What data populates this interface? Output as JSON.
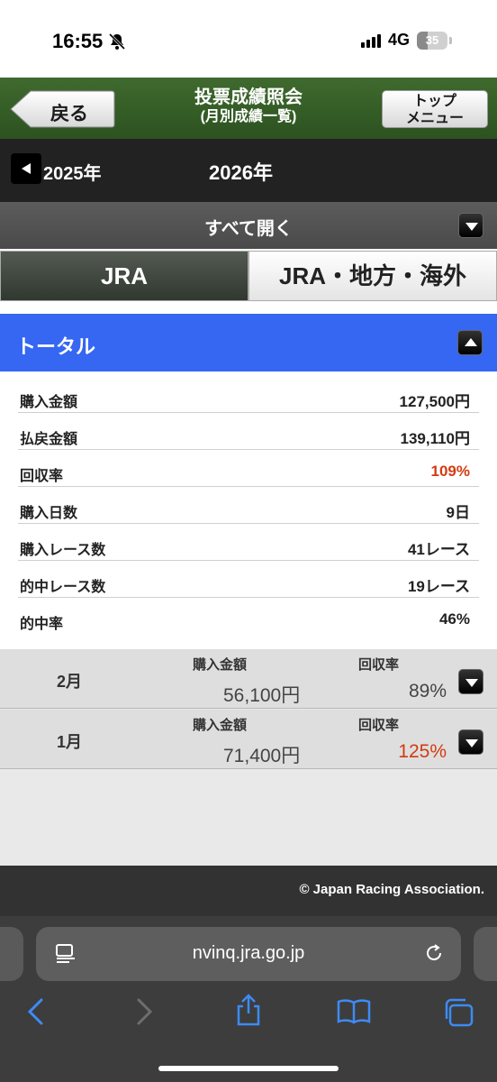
{
  "status_bar": {
    "time": "16:55",
    "network": "4G",
    "battery": "35"
  },
  "header": {
    "back_label": "戻る",
    "title_line1": "投票成績照会",
    "title_line2": "(月別成績一覧)",
    "top_menu_line1": "トップ",
    "top_menu_line2": "メニュー"
  },
  "year_nav": {
    "prev_year": "2025年",
    "current_year": "2026年"
  },
  "open_all": {
    "label": "すべて開く"
  },
  "tabs": [
    {
      "label": "JRA",
      "active": true
    },
    {
      "label": "JRA・地方・海外",
      "active": false
    }
  ],
  "total": {
    "title": "トータル",
    "rows": [
      {
        "label": "購入金額",
        "value": "127,500円"
      },
      {
        "label": "払戻金額",
        "value": "139,110円"
      },
      {
        "label": "回収率",
        "value": "109%",
        "highlight": true
      },
      {
        "label": "購入日数",
        "value": "9日"
      },
      {
        "label": "購入レース数",
        "value": "41レース"
      },
      {
        "label": "的中レース数",
        "value": "19レース"
      },
      {
        "label": "的中率",
        "value": "46%"
      }
    ]
  },
  "months": [
    {
      "month": "2月",
      "purchase_label": "購入金額",
      "purchase": "56,100円",
      "return_label": "回収率",
      "return_rate": "89%",
      "highlight": false
    },
    {
      "month": "1月",
      "purchase_label": "購入金額",
      "purchase": "71,400円",
      "return_label": "回収率",
      "return_rate": "125%",
      "highlight": true
    }
  ],
  "footer": {
    "copyright": "© Japan Racing Association."
  },
  "browser": {
    "url": "nvinq.jra.go.jp"
  },
  "colors": {
    "header_green": "#3f6a2e",
    "total_blue": "#3567f2",
    "highlight_red": "#d23b12",
    "ios_blue": "#3d8bf5"
  }
}
